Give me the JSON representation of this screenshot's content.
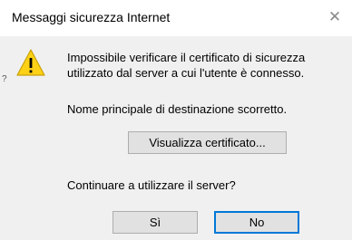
{
  "window": {
    "title": "Messaggi sicurezza Internet",
    "close_icon": "close-icon"
  },
  "icon": "warning-icon",
  "message": {
    "line1": "Impossibile verificare il certificato di sicurezza",
    "line2": "utilizzato dal server a cui l'utente è connesso.",
    "detail": "Nome principale di destinazione scorretto.",
    "question": "Continuare a utilizzare il server?"
  },
  "buttons": {
    "view_certificate": "Visualizza certificato...",
    "yes": "Sì",
    "no": "No"
  },
  "colors": {
    "warning_fill": "#fcd116",
    "focus_border": "#0078d7"
  }
}
